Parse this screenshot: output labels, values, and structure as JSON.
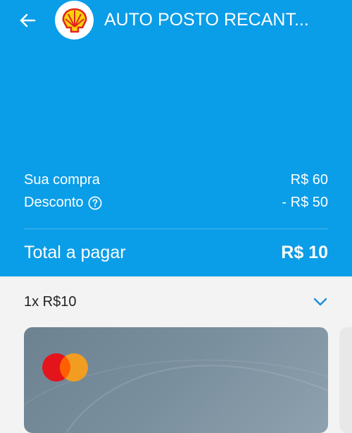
{
  "header": {
    "title": "AUTO POSTO RECANT...",
    "logo_icon": "shell-logo-icon",
    "background": "#0a9de8"
  },
  "summary": {
    "purchase_label": "Sua compra",
    "purchase_value": "R$ 60",
    "discount_label": "Desconto",
    "discount_value": "- R$ 50",
    "total_label": "Total a pagar",
    "total_value": "R$ 10"
  },
  "payment": {
    "installment_label": "1x R$10",
    "card_brand_icon": "mastercard-icon"
  },
  "colors": {
    "accent": "#0a9de8",
    "chevron": "#1a8fd8"
  }
}
